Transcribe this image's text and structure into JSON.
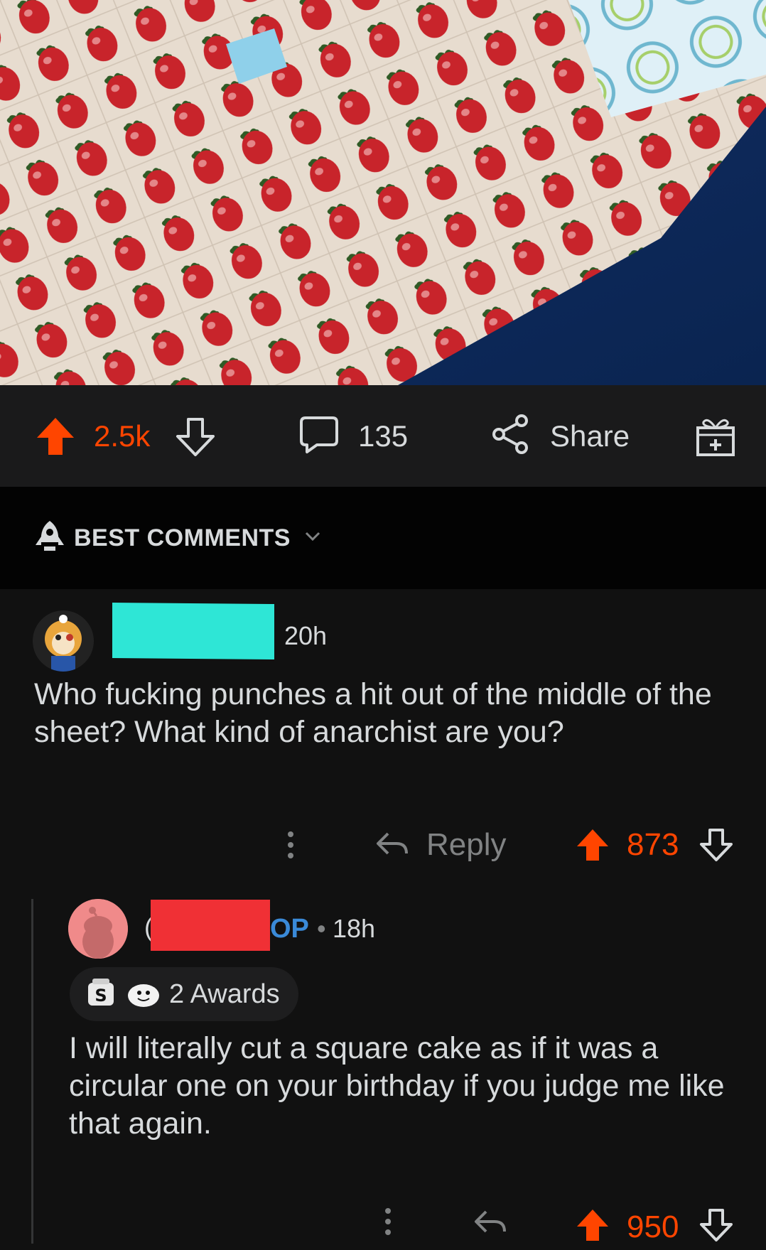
{
  "post": {
    "score": "2.5k",
    "comment_count": "135",
    "share_label": "Share"
  },
  "sort": {
    "label": "BEST COMMENTS"
  },
  "comments": [
    {
      "age": "20h",
      "body": "Who fucking punches a hit out of the middle of the sheet? What kind of anarchist are you?",
      "reply_label": "Reply",
      "score": "873"
    },
    {
      "author_visible_initial": "(",
      "op_tag": "OP",
      "separator": "•",
      "age": "18h",
      "awards_label": "2 Awards",
      "body": "I will literally cut a square cake as if it was a circular one on your birthday if you judge me like that again.",
      "score": "950"
    }
  ],
  "colors": {
    "upvote": "#ff4500",
    "background": "#111111",
    "action_bar": "#1a1a1b",
    "sort_bar": "#030303",
    "op_tag": "#3a8ad8",
    "redaction_1": "#2ee6d6",
    "redaction_2": "#f03035"
  },
  "icons": {
    "upvote": "upvote-arrow-icon",
    "downvote": "downvote-arrow-icon",
    "comments": "speech-bubble-icon",
    "share": "share-nodes-icon",
    "award": "gift-box-icon",
    "sort": "rocket-icon",
    "reply": "reply-arrow-icon",
    "more": "vertical-dots-icon"
  }
}
